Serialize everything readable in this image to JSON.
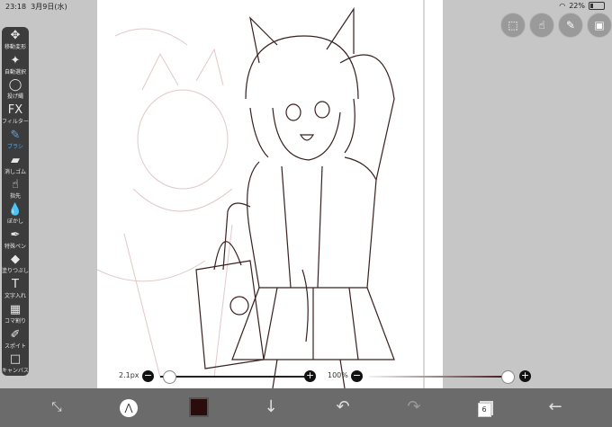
{
  "status": {
    "time": "23:18",
    "date": "3月9日(水)",
    "battery": "22%"
  },
  "tools": [
    {
      "label": "移動変形",
      "icon": "move-icon",
      "glyph": "✥"
    },
    {
      "label": "自動選択",
      "icon": "magic-wand-icon",
      "glyph": "✦"
    },
    {
      "label": "投げ縄",
      "icon": "lasso-icon",
      "glyph": "◯"
    },
    {
      "label": "フィルター",
      "icon": "filter-fx-icon",
      "glyph": "FX"
    },
    {
      "label": "ブラシ",
      "icon": "brush-icon",
      "glyph": "✎"
    },
    {
      "label": "消しゴム",
      "icon": "eraser-icon",
      "glyph": "▰"
    },
    {
      "label": "指先",
      "icon": "finger-icon",
      "glyph": "☝"
    },
    {
      "label": "ぼかし",
      "icon": "blur-drop-icon",
      "glyph": "💧"
    },
    {
      "label": "特殊ペン",
      "icon": "special-pen-icon",
      "glyph": "✒"
    },
    {
      "label": "塗りつぶし",
      "icon": "bucket-icon",
      "glyph": "◆"
    },
    {
      "label": "文字入れ",
      "icon": "text-icon",
      "glyph": "T"
    },
    {
      "label": "コマ割り",
      "icon": "frame-divide-icon",
      "glyph": "▦"
    },
    {
      "label": "スポイト",
      "icon": "eyedropper-icon",
      "glyph": "✐"
    },
    {
      "label": "キャンバス",
      "icon": "canvas-icon",
      "glyph": "□"
    }
  ],
  "active_tool": "ブラシ",
  "top_buttons": [
    {
      "icon": "selection-icon",
      "glyph": "⬚"
    },
    {
      "icon": "hand-gesture-icon",
      "glyph": "☝"
    },
    {
      "icon": "ruler-icon",
      "glyph": "✎"
    },
    {
      "icon": "reference-image-icon",
      "glyph": "▣"
    }
  ],
  "brush_size": {
    "label": "2.1px",
    "level": 0.02
  },
  "opacity": {
    "label": "100%",
    "level": 1.0
  },
  "bottom": {
    "layer_count": "6"
  },
  "colors": {
    "current_color": "#2a0c0c",
    "active_tool": "#5aa7e6"
  }
}
